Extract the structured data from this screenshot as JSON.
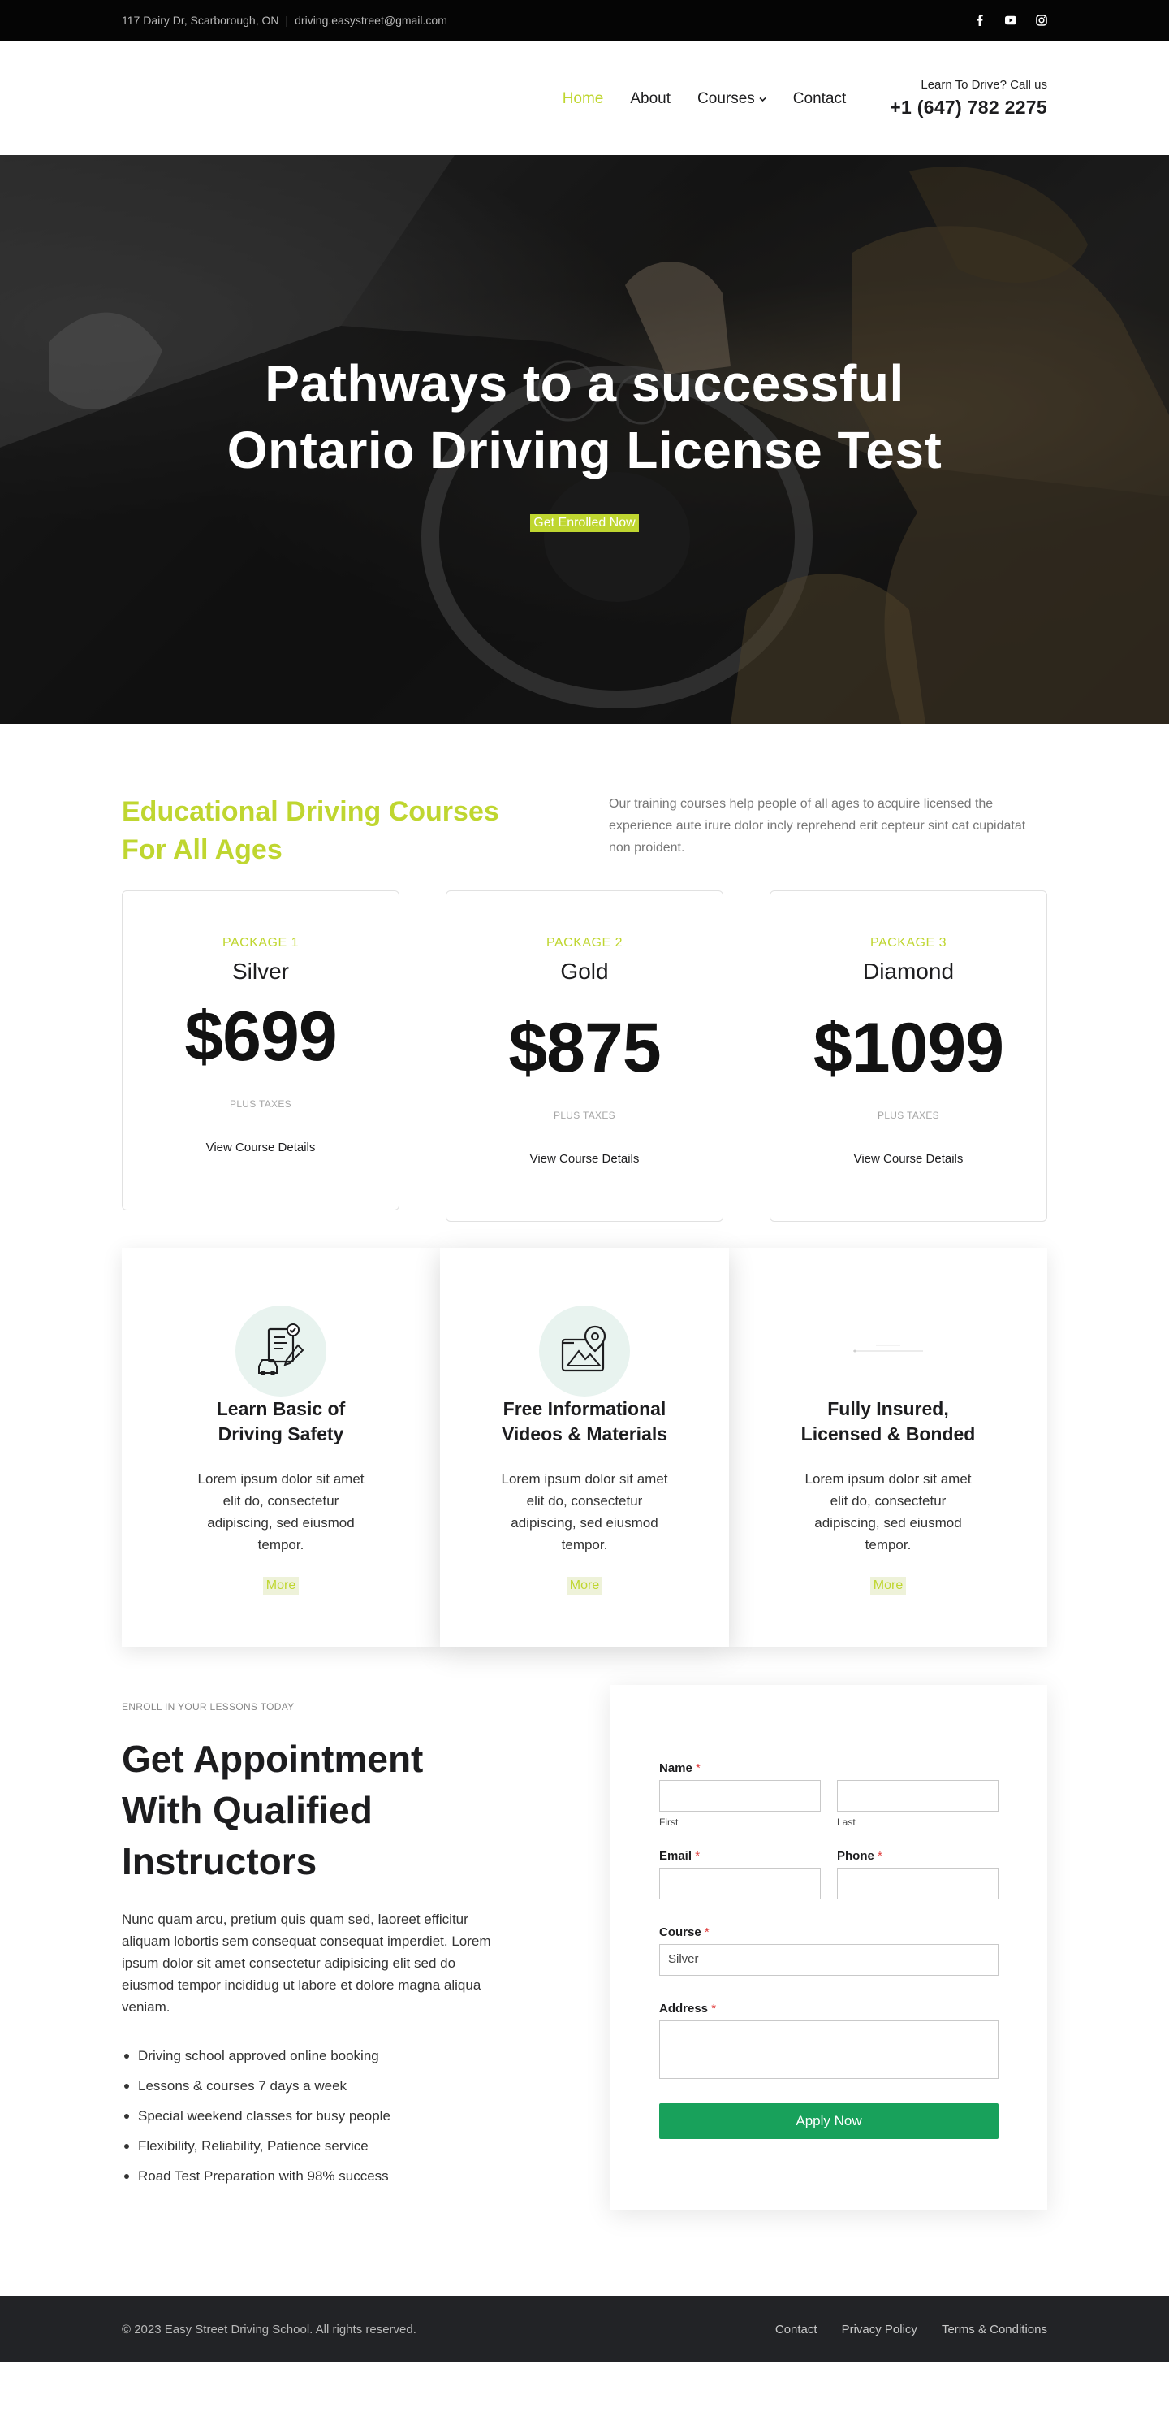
{
  "topbar": {
    "address": "117 Dairy Dr, Scarborough, ON",
    "separator": "|",
    "email": "driving.easystreet@gmail.com",
    "social_icons": [
      "facebook-icon",
      "youtube-icon",
      "instagram-icon"
    ]
  },
  "header": {
    "nav": {
      "home": "Home",
      "about": "About",
      "courses": "Courses",
      "contact": "Contact"
    },
    "call_label": "Learn To Drive? Call us",
    "phone": "+1 (647) 782 2275"
  },
  "hero": {
    "title_line1": "Pathways to a successful",
    "title_line2": "Ontario Driving License Test",
    "cta": "Get Enrolled Now"
  },
  "courses": {
    "heading_line1": "Educational Driving Courses",
    "heading_line2": "For All Ages",
    "intro": "Our training courses help people of all ages to acquire licensed the experience aute irure dolor incly reprehend erit cepteur sint cat cupidatat non proident.",
    "packages": [
      {
        "package": "PACKAGE 1",
        "tier": "Silver",
        "price": "$699",
        "taxes": "PLUS TAXES",
        "link": "View Course Details"
      },
      {
        "package": "PACKAGE 2",
        "tier": "Gold",
        "price": "$875",
        "taxes": "PLUS TAXES",
        "link": "View Course Details"
      },
      {
        "package": "PACKAGE 3",
        "tier": "Diamond",
        "price": "$1099",
        "taxes": "PLUS TAXES",
        "link": "View Course Details"
      }
    ]
  },
  "features": [
    {
      "title_line1": "Learn Basic of",
      "title_line2": "Driving Safety",
      "desc": "Lorem ipsum dolor sit amet elit do, consectetur adipiscing, sed eiusmod tempor.",
      "more": "More",
      "icon": "checklist-car-icon"
    },
    {
      "title_line1": "Free Informational",
      "title_line2": "Videos & Materials",
      "desc": "Lorem ipsum dolor sit amet elit do, consectetur adipiscing, sed eiusmod tempor.",
      "more": "More",
      "icon": "map-pin-icon"
    },
    {
      "title_line1": "Fully Insured,",
      "title_line2": "Licensed & Bonded",
      "desc": "Lorem ipsum dolor sit amet elit do, consectetur adipiscing, sed eiusmod tempor.",
      "more": "More",
      "icon": "shield-icon"
    }
  ],
  "appointment": {
    "eyebrow": "ENROLL IN YOUR LESSONS TODAY",
    "heading_line1": "Get Appointment",
    "heading_line2": "With Qualified",
    "heading_line3": "Instructors",
    "lead": "Nunc quam arcu, pretium quis quam sed, laoreet efficitur aliquam lobortis sem consequat consequat imperdiet. Lorem ipsum dolor sit amet consectetur adipisicing elit sed do eiusmod tempor incididug ut labore et dolore magna aliqua veniam.",
    "bullets": [
      "Driving school approved online booking",
      "Lessons & courses 7 days a week",
      "Special weekend classes for busy people",
      "Flexibility, Reliability, Patience service",
      "Road Test Preparation with 98% success"
    ]
  },
  "form": {
    "name_label": "Name",
    "required_mark": "*",
    "first_sub": "First",
    "last_sub": "Last",
    "email_label": "Email",
    "phone_label": "Phone",
    "course_label": "Course",
    "course_value": "Silver",
    "address_label": "Address",
    "submit": "Apply Now"
  },
  "footer": {
    "copyright": "© 2023 Easy Street Driving School. All rights reserved.",
    "links": [
      "Contact",
      "Privacy Policy",
      "Terms & Conditions"
    ]
  },
  "colors": {
    "accent": "#bfd630",
    "button_green": "#18a15b",
    "topbar_bg": "#050505",
    "footer_bg": "#222326",
    "icon_circle": "#e8f3ef"
  }
}
